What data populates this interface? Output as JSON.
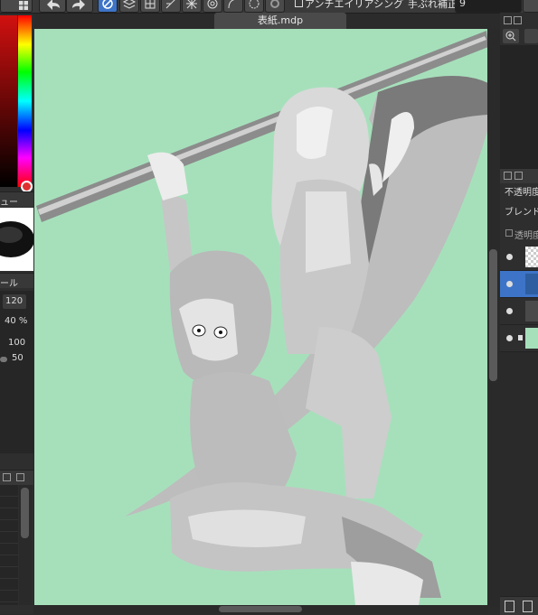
{
  "toolbar": {
    "antialias_label": "アンチエイリアシング",
    "stabilizer_label": "手ぶれ補正",
    "stabilizer_value": "9"
  },
  "document": {
    "tab_title": "表紙.mdp"
  },
  "left_panel": {
    "brush_panel_title": "ュー",
    "tool_panel_title": "ール",
    "size_value": "120",
    "opacity_value": "40 %",
    "param1_value": "100",
    "param2_value": "50"
  },
  "layers_panel": {
    "opacity_label": "不透明度",
    "blend_label": "ブレンド",
    "protect_alpha_label": "透明度"
  },
  "colors": {
    "canvas_bg": "#a6e0bb",
    "accent": "#3d74c7"
  }
}
